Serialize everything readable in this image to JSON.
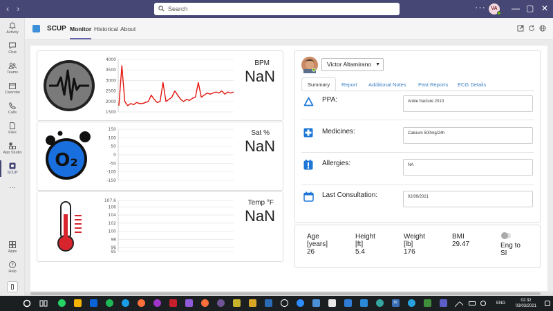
{
  "titlebar": {
    "search_placeholder": "Search",
    "more": "···",
    "avatar_initials": "VA",
    "window_buttons": [
      "—",
      "▢",
      "✕"
    ]
  },
  "rail": {
    "items": [
      {
        "label": "Activity",
        "icon": "bell-icon"
      },
      {
        "label": "Chat",
        "icon": "chat-icon"
      },
      {
        "label": "Teams",
        "icon": "teams-icon"
      },
      {
        "label": "Calendar",
        "icon": "calendar-icon"
      },
      {
        "label": "Calls",
        "icon": "phone-icon"
      },
      {
        "label": "Files",
        "icon": "file-icon"
      },
      {
        "label": "App Studio",
        "icon": "app-studio-icon"
      },
      {
        "label": "SCUP",
        "icon": "scup-icon"
      },
      {
        "label": "···",
        "icon": "more-icon"
      },
      {
        "label": "Apps",
        "icon": "apps-icon"
      },
      {
        "label": "Help",
        "icon": "help-icon"
      }
    ]
  },
  "app": {
    "name": "SCUP",
    "tabs": [
      "Monitor",
      "Historical",
      "About"
    ],
    "active_tab": "Monitor",
    "accent": "#6264a7"
  },
  "vitals": {
    "bpm": {
      "title": "BPM",
      "value": "NaN",
      "icon": "heart-rate-icon"
    },
    "sat": {
      "title": "Sat %",
      "value": "NaN",
      "icon": "o2-icon",
      "icon_text": "O₂"
    },
    "temp": {
      "title": "Temp °F",
      "value": "NaN",
      "icon": "thermometer-icon"
    }
  },
  "chart_data": [
    {
      "type": "line",
      "series": [
        {
          "values": [
            1800,
            3700,
            2000,
            1800,
            1900,
            1850,
            1950,
            1900,
            1900,
            1950,
            2000,
            2300,
            2100,
            1950,
            2000,
            2900,
            2000,
            2100,
            2200,
            2500,
            2300,
            2100,
            2000,
            2100,
            2050,
            2150,
            2200,
            2900,
            2200,
            2300,
            2400,
            2350,
            2400,
            2450,
            2400,
            2500,
            2350,
            2450,
            2400,
            2450
          ]
        }
      ],
      "yticks": [
        1500,
        2000,
        2500,
        3000,
        3500,
        4000
      ],
      "ylim": [
        1500,
        4000
      ],
      "color": "#e3130b"
    },
    {
      "type": "line",
      "series": [],
      "yticks": [
        150,
        100,
        50,
        0,
        -50,
        -100,
        -150
      ],
      "ylim": [
        -150,
        150
      ]
    },
    {
      "type": "line",
      "series": [],
      "yticks": [
        107.6,
        106,
        104,
        102,
        100,
        98,
        96,
        95
      ],
      "ylim": [
        95,
        107.6
      ]
    }
  ],
  "patient": {
    "name": "Victor Altamirano",
    "tabs": [
      "Summary",
      "Report",
      "Additional Notes",
      "Past Reports",
      "ECG Details"
    ],
    "active_tab": "Summary",
    "fields": [
      {
        "label": "PPA:",
        "value": "Ankle fracture 2010",
        "icon": "triangle-icon"
      },
      {
        "label": "Medicines:",
        "value": "Calcium 500mg/24h",
        "icon": "medicine-plus-icon"
      },
      {
        "label": "Allergies:",
        "value": "NA",
        "icon": "allergy-alert-icon"
      },
      {
        "label": "Last Consultation:",
        "value": "02/09/2021",
        "icon": "calendar-icon"
      }
    ],
    "stats": {
      "age_label": "Age",
      "age_unit": "[years]",
      "age": "26",
      "height_label": "Height",
      "height_unit": "[ft]",
      "height": "5.4",
      "weight_label": "Weight",
      "weight_unit": "[lb]",
      "weight": "176",
      "bmi_label": "BMI",
      "bmi": "29.47",
      "toggle_label_1": "Eng to",
      "toggle_label_2": "SI"
    }
  },
  "taskbar": {
    "lang": "ENG",
    "time": "02:32",
    "date": "03/03/2021",
    "badge": "16"
  }
}
